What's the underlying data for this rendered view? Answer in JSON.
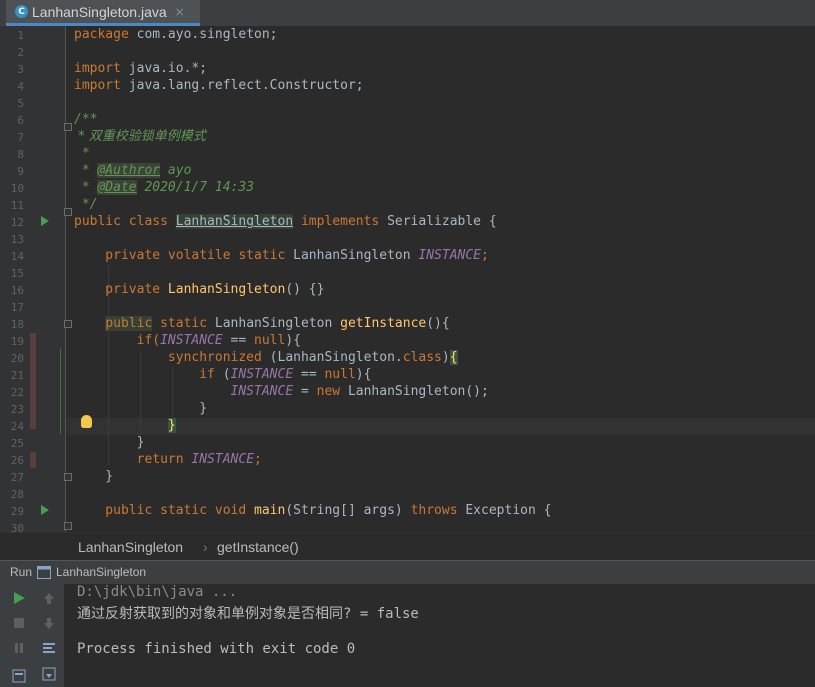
{
  "tab": {
    "icon": "C",
    "title": "LanhanSingleton.java",
    "close": "×"
  },
  "editor": {
    "line_numbers": [
      "1",
      "2",
      "3",
      "4",
      "5",
      "6",
      "7",
      "8",
      "9",
      "10",
      "11",
      "12",
      "13",
      "14",
      "15",
      "16",
      "17",
      "18",
      "19",
      "20",
      "21",
      "22",
      "23",
      "24",
      "25",
      "26",
      "27",
      "28",
      "29",
      "30"
    ],
    "code": {
      "l1_kw": "package",
      "l1_rest": " com.ayo.singleton;",
      "l3_kw": "import",
      "l3_rest": " java.io.*;",
      "l4_kw": "import",
      "l4_rest": " java.lang.reflect.Constructor;",
      "l6": "/**",
      "l7": " * 双重校验锁单例模式",
      "l8": " *",
      "l9_pre": " * ",
      "l9_tag": "@Authror",
      "l9_post": " ayo",
      "l10_pre": " * ",
      "l10_tag": "@Date",
      "l10_post": " 2020/1/7 14:33",
      "l11": " */",
      "l12_kw": "public class ",
      "l12_cls": "LanhanSingleton",
      "l12_kw2": " implements ",
      "l12_rest": "Serializable {",
      "l14_kw": "    private volatile static ",
      "l14_cls": "LanhanSingleton ",
      "l14_st": "INSTANCE",
      "l14_end": ";",
      "l16_kw": "    private ",
      "l16_fn": "LanhanSingleton",
      "l16_rest": "() {}",
      "l18_kw": "public",
      "l18_kw2": " static ",
      "l18_cls": "LanhanSingleton ",
      "l18_fn": "getInstance",
      "l18_rest": "(){",
      "l19_kw": "        if(",
      "l19_st": "INSTANCE",
      "l19_mid": " == ",
      "l19_kw2": "null",
      "l19_end": "){",
      "l20_kw": "            synchronized ",
      "l20_rest": "(LanhanSingleton.",
      "l20_kw2": "class",
      "l20_end": ")",
      "l20_brace": "{",
      "l21_kw": "                if ",
      "l21_p": "(",
      "l21_st": "INSTANCE",
      "l21_mid": " == ",
      "l21_kw2": "null",
      "l21_end": "){",
      "l22_st": "                    INSTANCE",
      "l22_mid": " = ",
      "l22_kw": "new ",
      "l22_rest": "LanhanSingleton();",
      "l23": "                }",
      "l24_brace": "}",
      "l25": "        }",
      "l26_kw": "        return ",
      "l26_st": "INSTANCE",
      "l26_end": ";",
      "l27": "    }",
      "l29_kw": "    public static void ",
      "l29_fn": "main",
      "l29_rest": "(String[] args) ",
      "l29_kw2": "throws ",
      "l29_end": "Exception {"
    },
    "colors": {
      "keyword": "#cc7832",
      "comment": "#629755",
      "function": "#ffc66d",
      "static_field": "#9876aa",
      "text": "#a9b7c6"
    }
  },
  "breadcrumb": {
    "class_name": "LanhanSingleton",
    "separator": "›",
    "method": "getInstance()"
  },
  "run": {
    "label": "Run",
    "config": "LanhanSingleton",
    "output": [
      "D:\\jdk\\bin\\java ...",
      "通过反射获取到的对象和单例对象是否相同? = false",
      "Process finished with exit code 0"
    ]
  }
}
